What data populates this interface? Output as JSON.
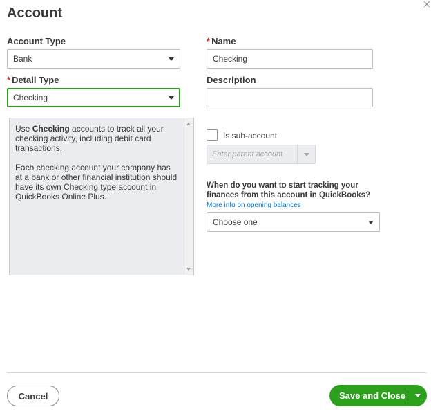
{
  "dialog": {
    "title": "Account"
  },
  "fields": {
    "account_type": {
      "label": "Account Type",
      "value": "Bank"
    },
    "name": {
      "required_mark": "*",
      "label": "Name",
      "value": "Checking"
    },
    "detail_type": {
      "required_mark": "*",
      "label": "Detail Type",
      "value": "Checking"
    },
    "description": {
      "label": "Description",
      "value": ""
    }
  },
  "info_box": {
    "para1_prefix": "Use ",
    "para1_bold": "Checking",
    "para1_suffix": " accounts to track all your checking activity, including debit card transactions.",
    "para2": "Each checking account your company has at a bank or other financial institution should have its own Checking type account in QuickBooks Online Plus."
  },
  "subaccount": {
    "checkbox_label": "Is sub-account",
    "parent_placeholder": "Enter parent account"
  },
  "tracking": {
    "question": "When do you want to start tracking your finances from this account in QuickBooks?",
    "link": "More info on opening balances",
    "select_value": "Choose one"
  },
  "footer": {
    "cancel_label": "Cancel",
    "save_label": "Save and Close"
  },
  "colors": {
    "accent_green": "#2ca01c",
    "link_blue": "#0077c5",
    "required_red": "#d52b1e"
  }
}
